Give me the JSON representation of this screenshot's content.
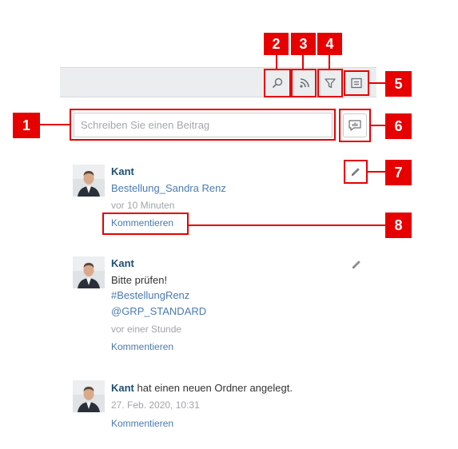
{
  "composer": {
    "placeholder": "Schreiben Sie einen Beitrag"
  },
  "toolbar": {
    "buttons": [
      "search-icon",
      "rss-icon",
      "filter-icon",
      "list-view-icon"
    ]
  },
  "feed": [
    {
      "author": "Kant",
      "line1": "Bestellung_Sandra Renz",
      "time": "vor 10 Minuten",
      "comment": "Kommentieren"
    },
    {
      "author": "Kant",
      "text": "Bitte prüfen!",
      "tag": "#BestellungRenz",
      "mention": "@GRP_STANDARD",
      "time": "vor einer Stunde",
      "comment": "Kommentieren"
    },
    {
      "author": "Kant",
      "action": "hat einen neuen Ordner angelegt.",
      "time": "27. Feb. 2020, 10:31",
      "comment": "Kommentieren"
    }
  ],
  "callouts": [
    "1",
    "2",
    "3",
    "4",
    "5",
    "6",
    "7",
    "8"
  ],
  "colors": {
    "callout": "#e60000",
    "link": "#4a7ab0",
    "author": "#1f4f73"
  }
}
